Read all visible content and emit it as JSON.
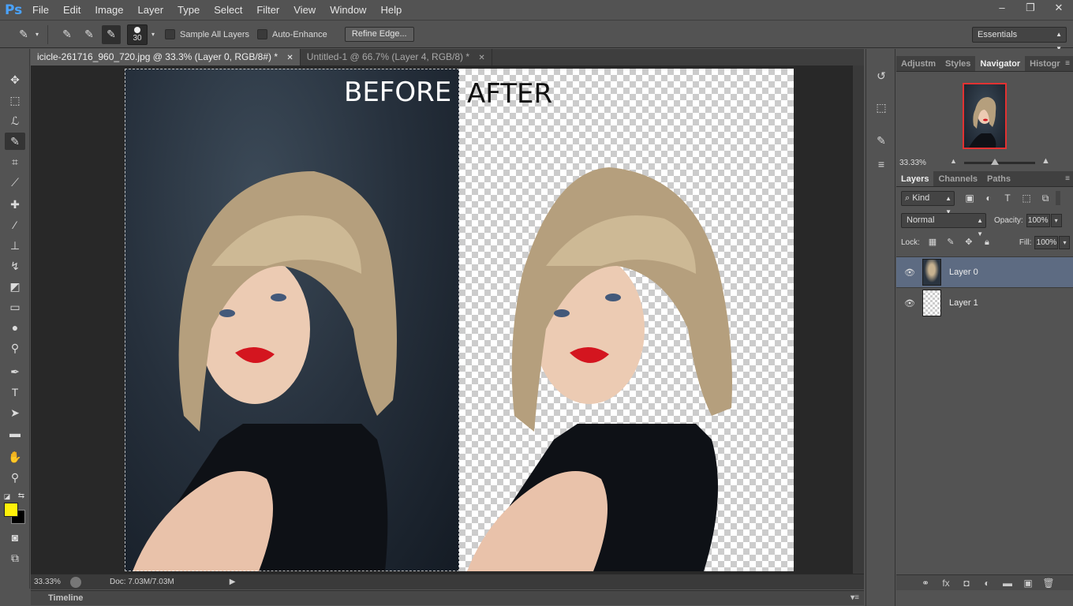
{
  "app": {
    "logo": "Ps"
  },
  "menu": [
    "File",
    "Edit",
    "Image",
    "Layer",
    "Type",
    "Select",
    "Filter",
    "View",
    "Window",
    "Help"
  ],
  "window_controls": {
    "minimize": "–",
    "restore": "❐",
    "close": "✕"
  },
  "options_bar": {
    "brush_size": "30",
    "sample_all_layers": "Sample All Layers",
    "auto_enhance": "Auto-Enhance",
    "refine_edge": "Refine Edge...",
    "workspace": "Essentials"
  },
  "tabs": [
    {
      "label": "icicle-261716_960_720.jpg @ 33.3% (Layer 0, RGB/8#) *",
      "active": true
    },
    {
      "label": "Untitled-1 @ 66.7% (Layer 4, RGB/8) *",
      "active": false
    }
  ],
  "canvas": {
    "before_label": "BEFORE",
    "after_label": "AFTER"
  },
  "status": {
    "zoom": "33.33%",
    "doc_info": "Doc: 7.03M/7.03M",
    "arrow": "▶"
  },
  "timeline": {
    "label": "Timeline"
  },
  "panels": {
    "top_tabs": [
      "Adjustm",
      "Styles",
      "Navigator",
      "Histogr"
    ],
    "navigator_zoom": "33.33%",
    "layer_tabs": [
      "Layers",
      "Channels",
      "Paths"
    ],
    "kind": "Kind",
    "blend_mode": "Normal",
    "opacity_label": "Opacity:",
    "opacity_value": "100%",
    "lock_label": "Lock:",
    "fill_label": "Fill:",
    "fill_value": "100%",
    "layers": [
      {
        "name": "Layer 0",
        "selected": true
      },
      {
        "name": "Layer 1",
        "selected": false
      }
    ]
  },
  "colors": {
    "foreground": "#fff10a",
    "background": "#000000",
    "selection_highlight": "#5d6b82"
  }
}
